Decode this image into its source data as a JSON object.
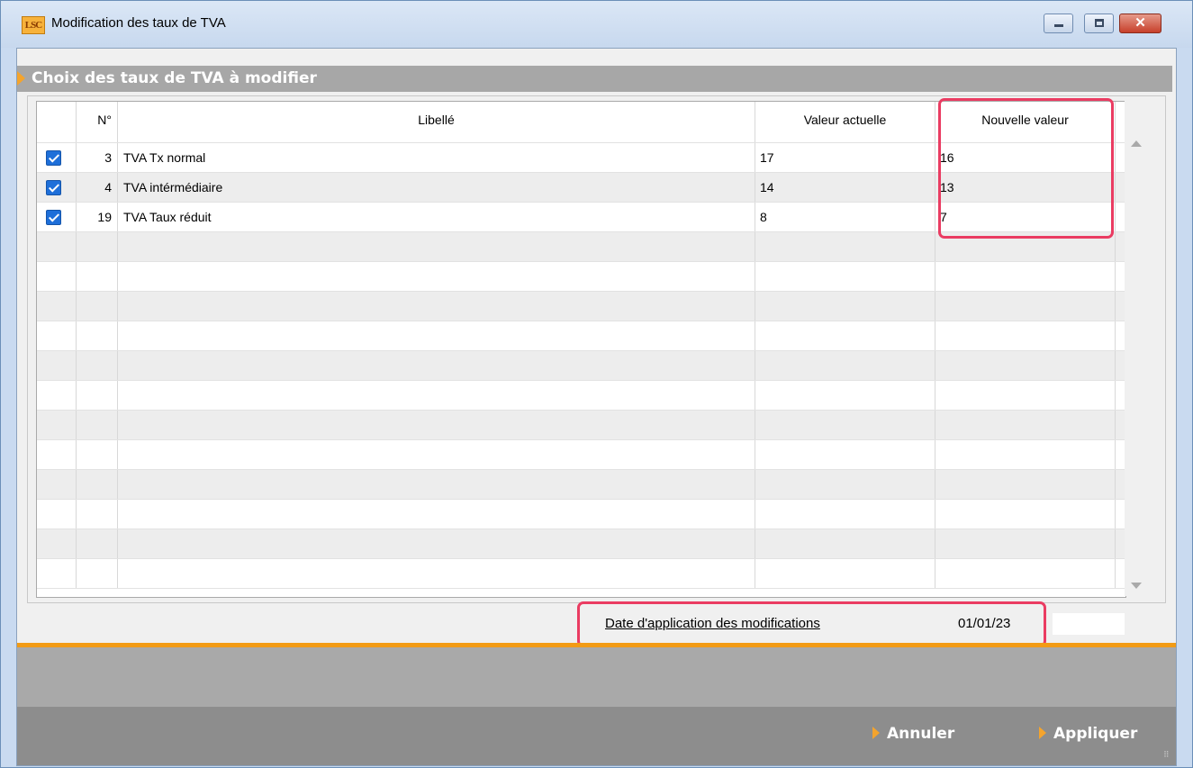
{
  "window": {
    "title": "Modification des taux de TVA",
    "app_icon_text": "LSC",
    "close_glyph": "✕"
  },
  "section": {
    "title": "Choix des taux de TVA à modifier"
  },
  "table": {
    "headers": {
      "num": "N°",
      "libelle": "Libellé",
      "valeur_actuelle": "Valeur actuelle",
      "nouvelle_valeur": "Nouvelle valeur"
    },
    "rows": [
      {
        "checked": true,
        "num": "3",
        "libelle": "TVA Tx normal",
        "valeur_actuelle": "17",
        "nouvelle_valeur": "16"
      },
      {
        "checked": true,
        "num": "4",
        "libelle": "TVA intérmédiaire",
        "valeur_actuelle": "14",
        "nouvelle_valeur": "13"
      },
      {
        "checked": true,
        "num": "19",
        "libelle": "TVA Taux réduit",
        "valeur_actuelle": "8",
        "nouvelle_valeur": "7"
      }
    ],
    "empty_row_count": 12
  },
  "date": {
    "label": "Date d'application des modifications",
    "value": "01/01/23"
  },
  "footer": {
    "cancel_label": "Annuler",
    "apply_label": "Appliquer"
  },
  "colors": {
    "accent_orange": "#f29b15",
    "highlight": "#ea3c62",
    "checkbox": "#1e6fd9",
    "section_header": "#a7a7a7",
    "footer": "#8d8d8d"
  }
}
